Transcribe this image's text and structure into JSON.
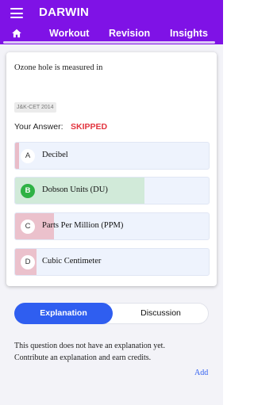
{
  "app": {
    "title": "DARWIN"
  },
  "tabs": [
    {
      "label": "Workout"
    },
    {
      "label": "Revision"
    },
    {
      "label": "Insights"
    }
  ],
  "question": {
    "text": "Ozone hole is measured in",
    "exam_tag": "J&K-CET 2014",
    "your_answer_label": "Your Answer:",
    "your_answer_value": "SKIPPED",
    "options": [
      {
        "letter": "A",
        "text": "Decibel",
        "response_fraction": 0.02
      },
      {
        "letter": "B",
        "text": "Dobson Units (DU)",
        "response_fraction": 0.67,
        "correct": true
      },
      {
        "letter": "C",
        "text": "Parts Per Million (PPM)",
        "response_fraction": 0.2
      },
      {
        "letter": "D",
        "text": "Cubic Centimeter",
        "response_fraction": 0.11
      }
    ]
  },
  "explanation": {
    "tab_active": "Explanation",
    "tab_inactive": "Discussion",
    "line1": "This question does not have an explanation yet.",
    "line2": "Contribute an explanation and earn credits.",
    "add_label": "Add"
  },
  "colors": {
    "header": "#7f12e6",
    "correct": "#2fb245",
    "skipped": "#e2353f",
    "accent": "#2f5ef0"
  }
}
